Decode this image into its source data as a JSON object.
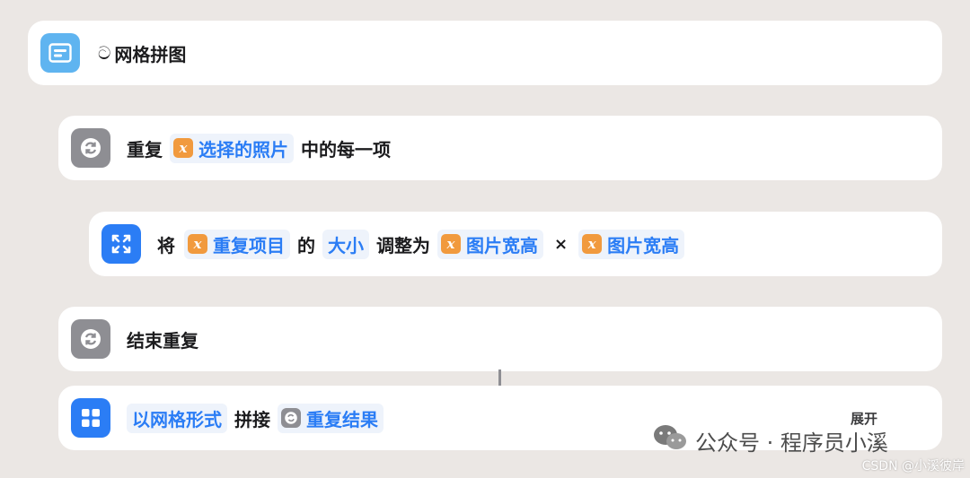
{
  "rows": {
    "grid_title": {
      "prefix": "ට",
      "label": "网格拼图",
      "icon": "text-list-icon"
    },
    "repeat": {
      "prefix": "重复",
      "var_symbol": "x",
      "var_label": "选择的照片",
      "suffix": "中的每一项",
      "icon": "repeat-icon"
    },
    "resize": {
      "prefix": "将",
      "var1_symbol": "x",
      "var1_label": "重复项目",
      "mid1": "的",
      "param_label": "大小",
      "mid2": "调整为",
      "var2_symbol": "x",
      "var2_label": "图片宽高",
      "times": "×",
      "var3_symbol": "x",
      "var3_label": "图片宽高",
      "icon": "expand-arrows-icon"
    },
    "end_repeat": {
      "label": "结束重复",
      "icon": "repeat-icon"
    },
    "combine": {
      "mode_label": "以网格形式",
      "mid": "拼接",
      "var_label": "重复结果",
      "expand_label": "展开",
      "icon": "grid-icon"
    }
  },
  "watermark": {
    "text": "公众号 · 程序员小溪",
    "csdn": "CSDN @小溪彼岸"
  },
  "colors": {
    "background": "#ebe7e4",
    "accent_blue": "#2b7df5",
    "variable_orange": "#f19a3e",
    "gray_icon": "#8e8e93",
    "light_blue_icon": "#5fb4f0"
  }
}
